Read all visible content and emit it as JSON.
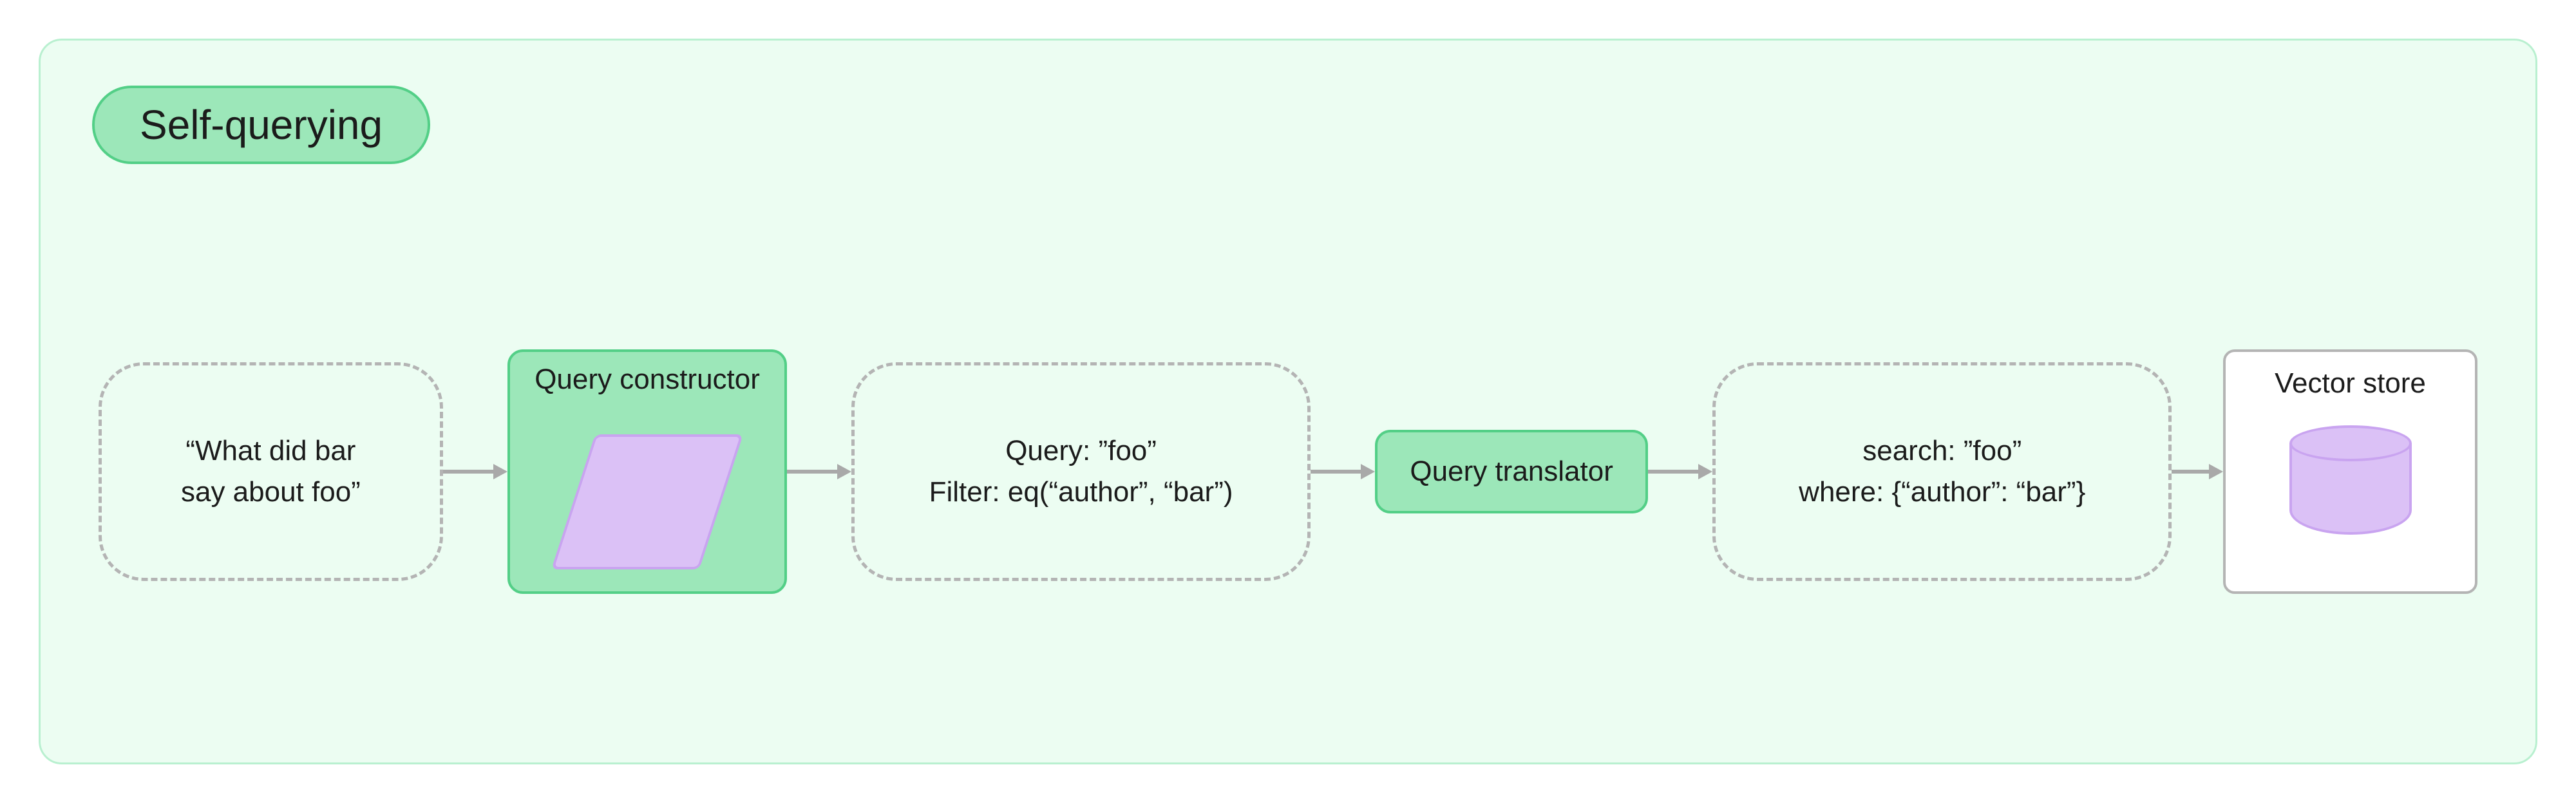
{
  "title": "Self-querying",
  "flow": {
    "input": {
      "line1": "“What did bar",
      "line2": "say about foo”"
    },
    "constructor": {
      "label": "Query constructor"
    },
    "structured": {
      "line1": "Query: ”foo”",
      "line2": "Filter: eq(“author”, “bar”)"
    },
    "translator": {
      "label": "Query translator"
    },
    "translated": {
      "line1": "search: ”foo”",
      "line2": "where: {“author”: “bar”}"
    },
    "store": {
      "label": "Vector store"
    }
  },
  "icons": {
    "parallelogram": "parallelogram-icon",
    "cylinder": "database-icon"
  },
  "colors": {
    "panel_bg": "#ecfdf2",
    "panel_border": "#b9f0d0",
    "green_fill": "#9ce7b9",
    "green_border": "#53cf87",
    "purple_fill": "#dbc1f6",
    "purple_border": "#c9a4f0",
    "dashed_border": "#b4b4b4",
    "arrow": "#a9a9a9"
  }
}
